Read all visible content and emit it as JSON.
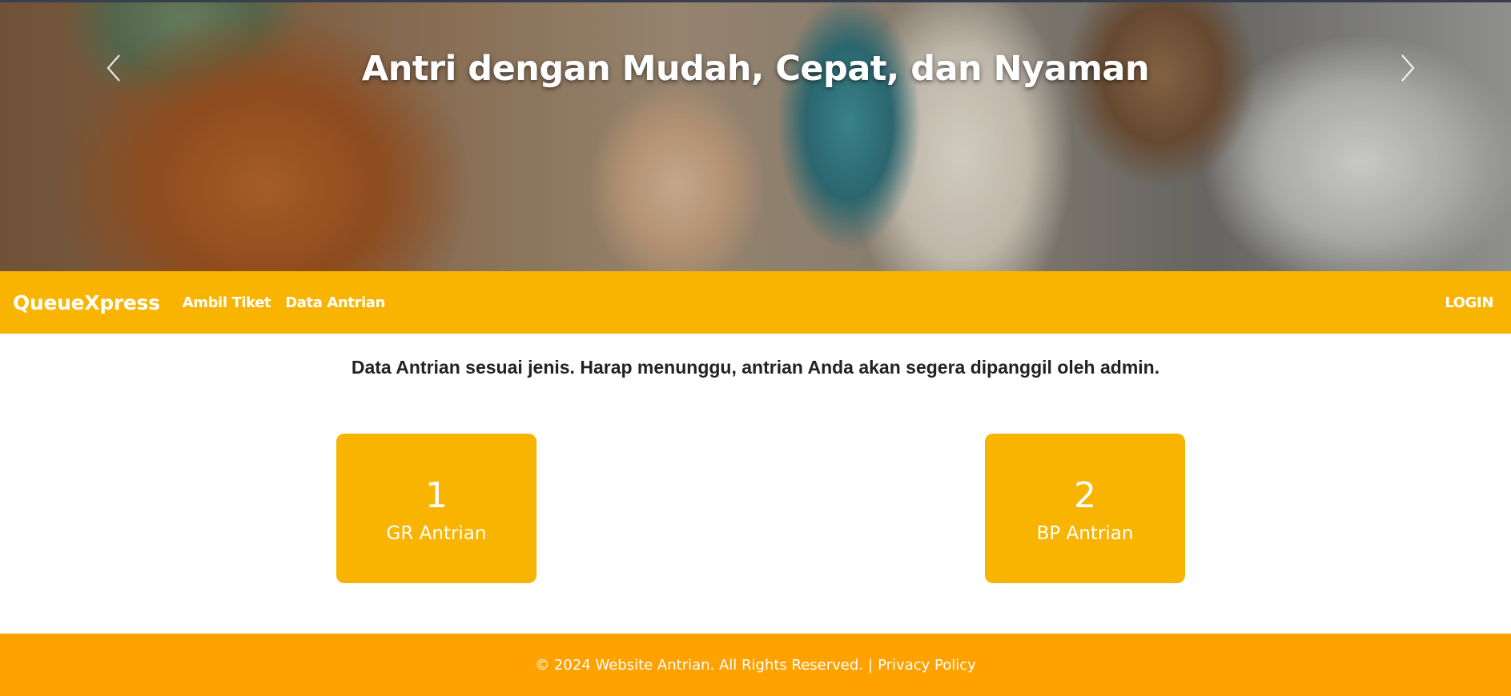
{
  "hero": {
    "caption": "Antri dengan Mudah, Cepat, dan Nyaman",
    "prev_icon": "chevron-left-icon",
    "next_icon": "chevron-right-icon"
  },
  "navbar": {
    "brand": "QueueXpress",
    "links": [
      "Ambil Tiket",
      "Data Antrian"
    ],
    "login": "LOGIN",
    "background": "#f8b400"
  },
  "main": {
    "intro": "Data Antrian sesuai jenis. Harap menunggu, antrian Anda akan segera dipanggil oleh admin.",
    "cards": [
      {
        "count": "1",
        "label": "GR Antrian"
      },
      {
        "count": "2",
        "label": "BP Antrian"
      }
    ]
  },
  "footer": {
    "copyright": "© 2024 Website Antrian. All Rights Reserved.",
    "separator": "|",
    "privacy": "Privacy Policy",
    "background": "#ffa200"
  }
}
